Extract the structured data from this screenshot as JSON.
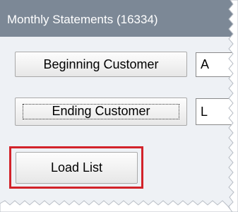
{
  "window": {
    "title": "Monthly Statements (16334)"
  },
  "form": {
    "beginning_customer_label": "Beginning Customer",
    "beginning_customer_value": "A",
    "ending_customer_label": "Ending Customer",
    "ending_customer_value": "L"
  },
  "actions": {
    "load_list_label": "Load List"
  },
  "colors": {
    "titlebar": "#7c8896",
    "window_bg": "#eef1f5",
    "highlight": "#d2232a"
  }
}
